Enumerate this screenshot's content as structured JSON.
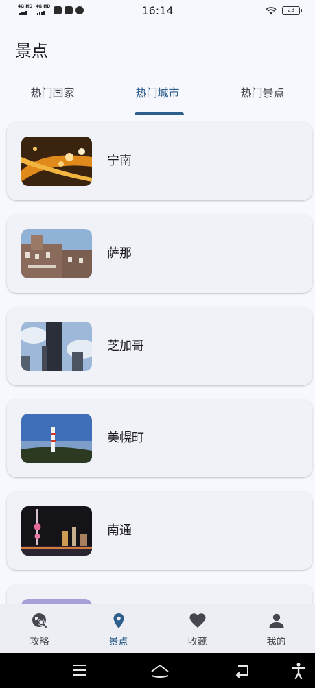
{
  "status_bar": {
    "signal_1": "4G HD",
    "signal_2": "4G HD",
    "time": "16:14",
    "battery": "23"
  },
  "page_title": "景点",
  "tabs": [
    {
      "label": "热门国家",
      "active": false
    },
    {
      "label": "热门城市",
      "active": true
    },
    {
      "label": "热门景点",
      "active": false
    }
  ],
  "cities": [
    {
      "name": "宁南",
      "image": "night-city-lights"
    },
    {
      "name": "萨那",
      "image": "old-stone-buildings"
    },
    {
      "name": "芝加哥",
      "image": "skyscraper-clouds"
    },
    {
      "name": "美幌町",
      "image": "tower-lake-view"
    },
    {
      "name": "南通",
      "image": "night-tower-skyline"
    },
    {
      "name": "",
      "image": "purple-partial"
    }
  ],
  "bottom_nav": [
    {
      "label": "攻略",
      "icon": "globe-search-icon",
      "active": false
    },
    {
      "label": "景点",
      "icon": "location-pin-icon",
      "active": true
    },
    {
      "label": "收藏",
      "icon": "heart-icon",
      "active": false
    },
    {
      "label": "我的",
      "icon": "person-icon",
      "active": false
    }
  ],
  "colors": {
    "accent": "#2e5e8c",
    "background": "#f7f8fd",
    "card": "#f1f2f8",
    "nav_bar": "#eceef4"
  }
}
